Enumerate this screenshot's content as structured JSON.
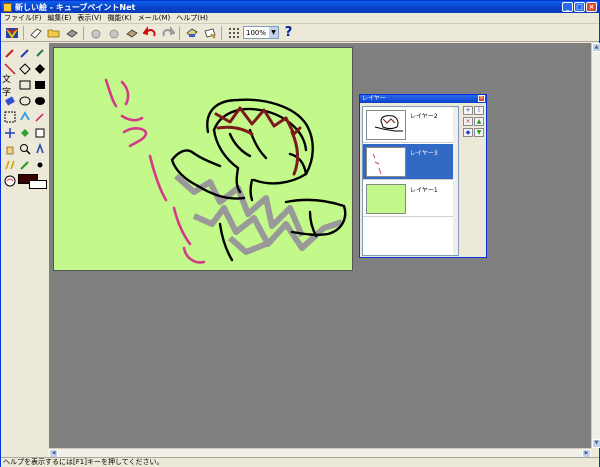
{
  "app": {
    "title": "新しい絵 - キューブペイントNet"
  },
  "menu": {
    "items": [
      {
        "label": "ファイル(F)"
      },
      {
        "label": "編集(E)"
      },
      {
        "label": "表示(V)"
      },
      {
        "label": "機能(K)"
      },
      {
        "label": "メール(M)"
      },
      {
        "label": "ヘルプ(H)"
      }
    ]
  },
  "toolbar": {
    "zoom_value": "100%",
    "help_glyph": "?"
  },
  "toolbox": {
    "text_tool_label": "文字"
  },
  "layers": {
    "panel_title": "レイヤー",
    "items": [
      {
        "name": "レイヤー2"
      },
      {
        "name": "レイヤー3"
      },
      {
        "name": "レイヤー1"
      }
    ]
  },
  "status": {
    "text": "ヘルプを表示するには[F1]キーを押してください。"
  },
  "colors": {
    "canvas_bg": "#c3f98a",
    "selection": "#316ac5",
    "workspace": "#808080"
  }
}
